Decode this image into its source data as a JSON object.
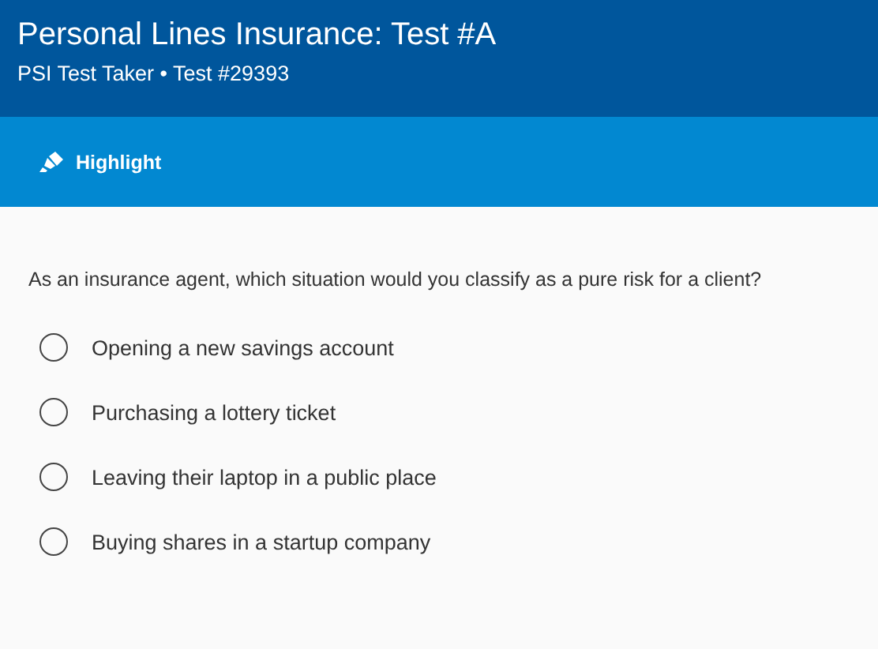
{
  "header": {
    "title": "Personal Lines Insurance: Test #A",
    "subtitle": "PSI Test Taker • Test #29393"
  },
  "toolbar": {
    "highlight_button": "Highlight"
  },
  "question": {
    "text": "As an insurance agent, which situation would you classify as a pure risk for a client?",
    "options": [
      {
        "label": "Opening a new savings account",
        "selected": false
      },
      {
        "label": "Purchasing a lottery ticket",
        "selected": false
      },
      {
        "label": "Leaving their laptop in a public place",
        "selected": false
      },
      {
        "label": "Buying shares in a startup company",
        "selected": false
      }
    ]
  }
}
